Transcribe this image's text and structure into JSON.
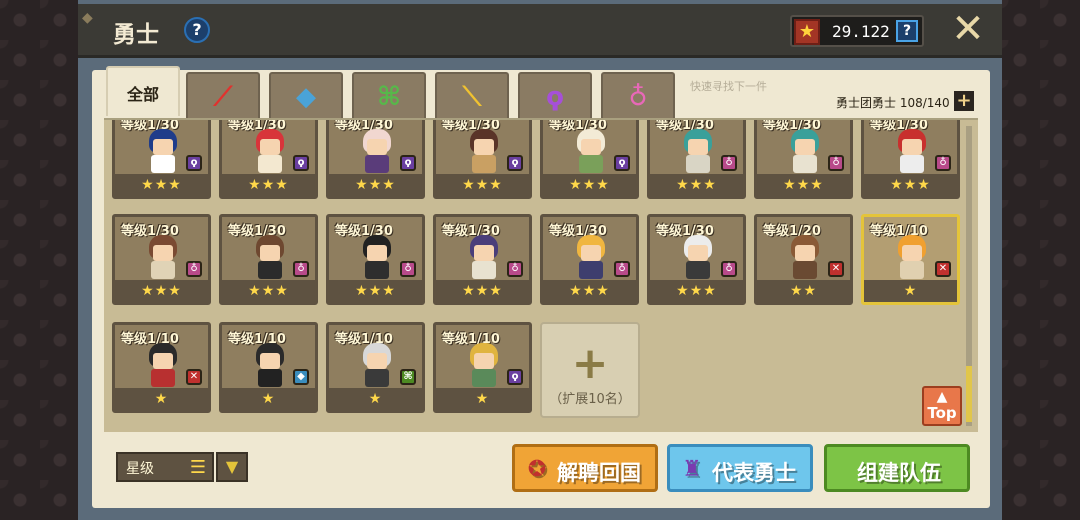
{
  "header": {
    "title": "勇士",
    "help": "?",
    "gem_value": "29.122",
    "gem_help": "?",
    "close": "✕"
  },
  "tabs": [
    {
      "label": "全部",
      "icon": "all-tab",
      "color": "#2b2416"
    },
    {
      "icon": "sword-icon",
      "glyph": "⟋",
      "color": "#e0322e"
    },
    {
      "icon": "axe-icon",
      "glyph": "◆",
      "color": "#4aa3d8"
    },
    {
      "icon": "bow-icon",
      "glyph": "⌘",
      "color": "#57b84a"
    },
    {
      "icon": "staff-icon",
      "glyph": "⟍",
      "color": "#f0c230"
    },
    {
      "icon": "wand-icon",
      "glyph": "ϙ",
      "color": "#a64fd8"
    },
    {
      "icon": "ring-icon",
      "glyph": "♁",
      "color": "#e868b8"
    }
  ],
  "hint": "快速寻找下一件",
  "hero_count": "勇士团勇士 108/140",
  "heroes": [
    {
      "level": "等级1/30",
      "stars": "★★★",
      "hair": "#1f3c8a",
      "body": "#ffffff",
      "wp": "#6a3fa0",
      "wpg": "ϙ"
    },
    {
      "level": "等级1/30",
      "stars": "★★★",
      "hair": "#d8343a",
      "body": "#f3e8d0",
      "wp": "#6a3fa0",
      "wpg": "ϙ"
    },
    {
      "level": "等级1/30",
      "stars": "★★★",
      "hair": "#f1d7d0",
      "body": "#5a3c7a",
      "wp": "#6a3fa0",
      "wpg": "ϙ"
    },
    {
      "level": "等级1/30",
      "stars": "★★★",
      "hair": "#5a3428",
      "body": "#c9a063",
      "wp": "#6a3fa0",
      "wpg": "ϙ"
    },
    {
      "level": "等级1/30",
      "stars": "★★★",
      "hair": "#f3ebd6",
      "body": "#7aa05a",
      "wp": "#6a3fa0",
      "wpg": "ϙ"
    },
    {
      "level": "等级1/30",
      "stars": "★★★",
      "hair": "#3aa09a",
      "body": "#d9d5c5",
      "wp": "#b84a8a",
      "wpg": "♁"
    },
    {
      "level": "等级1/30",
      "stars": "★★★",
      "hair": "#3aa09a",
      "body": "#e8e2d0",
      "wp": "#b84a8a",
      "wpg": "♁"
    },
    {
      "level": "等级1/30",
      "stars": "★★★",
      "hair": "#c8302e",
      "body": "#ededed",
      "wp": "#b84a8a",
      "wpg": "♁"
    },
    {
      "level": "等级1/30",
      "stars": "★★★",
      "hair": "#7a4a32",
      "body": "#e0d3b6",
      "wp": "#b84a8a",
      "wpg": "♁"
    },
    {
      "level": "等级1/30",
      "stars": "★★★",
      "hair": "#6e4830",
      "body": "#2b2b2b",
      "wp": "#b84a8a",
      "wpg": "♁"
    },
    {
      "level": "等级1/30",
      "stars": "★★★",
      "hair": "#222222",
      "body": "#2e2e2e",
      "wp": "#b84a8a",
      "wpg": "♁"
    },
    {
      "level": "等级1/30",
      "stars": "★★★",
      "hair": "#4a3e7a",
      "body": "#e8e2d0",
      "wp": "#b84a8a",
      "wpg": "♁"
    },
    {
      "level": "等级1/30",
      "stars": "★★★",
      "hair": "#f0b640",
      "body": "#3e3e6e",
      "wp": "#b84a8a",
      "wpg": "♁"
    },
    {
      "level": "等级1/30",
      "stars": "★★★",
      "hair": "#ececec",
      "body": "#3a3a3a",
      "wp": "#b84a8a",
      "wpg": "♁"
    },
    {
      "level": "等级1/20",
      "stars": "★★",
      "hair": "#8a5a36",
      "body": "#6a4a32",
      "wp": "#c0302e",
      "wpg": "✕"
    },
    {
      "level": "等级1/10",
      "stars": "★",
      "hair": "#f0a030",
      "body": "#e0d0b0",
      "wp": "#c0302e",
      "wpg": "✕",
      "gold": true
    },
    {
      "level": "等级1/10",
      "stars": "★",
      "hair": "#2a2a2a",
      "body": "#b83030",
      "wp": "#c0302e",
      "wpg": "✕"
    },
    {
      "level": "等级1/10",
      "stars": "★",
      "hair": "#2a2a2a",
      "body": "#222222",
      "wp": "#3a8dbd",
      "wpg": "◆"
    },
    {
      "level": "等级1/10",
      "stars": "★",
      "hair": "#d8d8d8",
      "body": "#3a3a3a",
      "wp": "#4d8a22",
      "wpg": "⌘"
    },
    {
      "level": "等级1/10",
      "stars": "★",
      "hair": "#e0b440",
      "body": "#5a8a5a",
      "wp": "#6a3fa0",
      "wpg": "ϙ"
    }
  ],
  "expand": {
    "plus": "+",
    "label": "（扩展10名）"
  },
  "top_button": {
    "arrow": "▲",
    "label": "Top"
  },
  "sort": {
    "label": "星级",
    "icon": "☰",
    "dropdown": "▼"
  },
  "buttons": {
    "dismiss": "解聘回国",
    "dismiss_icon": "✪",
    "rep": "代表勇士",
    "rep_icon": "♜",
    "team": "组建队伍"
  }
}
